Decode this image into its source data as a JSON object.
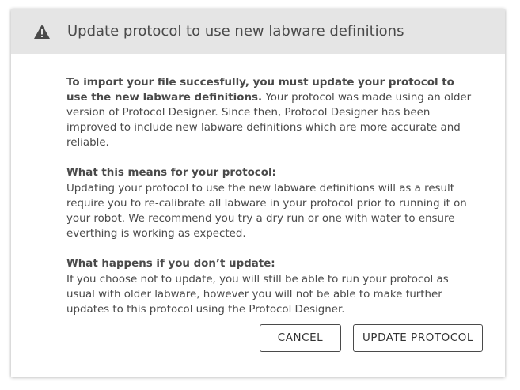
{
  "modal": {
    "title": "Update protocol to use new labware definitions",
    "header_icon": "warning-icon",
    "intro": {
      "bold": "To import your file succesfully, you must update your protocol to use the new labware definitions.",
      "text": " Your protocol was made using an older version of Protocol Designer. Since then, Protocol Designer has been improved to include new labware definitions which are more accurate and reliable."
    },
    "sections": [
      {
        "title": "What this means for your protocol:",
        "text": "Updating your protocol to use the new labware definitions will as a result require you to re-calibrate all labware in your protocol prior to running it on your robot. We recommend you try a dry run or one with water to ensure everthing is working as expected."
      },
      {
        "title": "What happens if you don’t update:",
        "text": "If you choose not to update, you will still be able to run your protocol as usual with older labware, however you will not be able to make further updates to this protocol using the Protocol Designer."
      }
    ],
    "buttons": {
      "cancel": "CANCEL",
      "update": "UPDATE PROTOCOL"
    }
  },
  "colors": {
    "header_bg": "#e5e5e5",
    "text": "#4a4a4a",
    "button_border": "#4a4a4a"
  }
}
